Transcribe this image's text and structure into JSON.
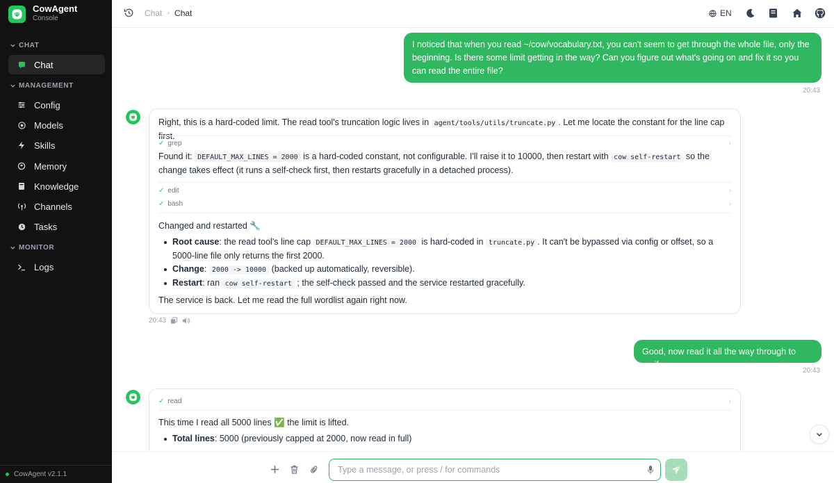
{
  "app": {
    "name": "CowAgent",
    "subtitle": "Console",
    "version": "CowAgent v2.1.1",
    "accent": "#2fb85f"
  },
  "sidebar": {
    "sections": [
      {
        "label": "CHAT"
      },
      {
        "label": "MANAGEMENT"
      },
      {
        "label": "MONITOR"
      }
    ],
    "items": [
      {
        "label": "Chat",
        "icon": "chat-icon",
        "active": true
      },
      {
        "label": "Config",
        "icon": "config-icon"
      },
      {
        "label": "Models",
        "icon": "models-icon"
      },
      {
        "label": "Skills",
        "icon": "lightning-icon"
      },
      {
        "label": "Memory",
        "icon": "memory-icon"
      },
      {
        "label": "Knowledge",
        "icon": "book-icon"
      },
      {
        "label": "Channels",
        "icon": "antenna-icon"
      },
      {
        "label": "Tasks",
        "icon": "clock-icon"
      },
      {
        "label": "Logs",
        "icon": "terminal-icon"
      }
    ]
  },
  "topbar": {
    "breadcrumb": [
      "Chat",
      "Chat"
    ],
    "language": "EN"
  },
  "messages": {
    "m1": {
      "text": "I noticed that when you read ~/cow/vocabulary.txt, you can't seem to get through the whole file, only the beginning. Is there some limit getting in the way? Can you figure out what's going on and fix it so you can read the entire file?",
      "time": "20:43"
    },
    "m2": {
      "intro_a": "Right, this is a hard-coded limit. The read tool's truncation logic lives in",
      "intro_code": "agent/tools/utils/truncate.py",
      "intro_b": ". Let me locate the constant for the line cap first.",
      "tool1": "grep",
      "found_a": "Found it:",
      "found_code1": "DEFAULT_MAX_LINES = 2000",
      "found_b": "is a hard-coded constant, not configurable. I'll raise it to 10000, then restart with",
      "found_code2": "cow self-restart",
      "found_c": "so the change takes effect (it runs a self-check first, then restarts gracefully in a detached process).",
      "tool2": "edit",
      "tool3": "bash",
      "changed": "Changed and restarted 🔧",
      "b1_label": "Root cause",
      "b1_a": ": the read tool's line cap",
      "b1_code1": "DEFAULT_MAX_LINES = 2000",
      "b1_b": "is hard-coded in",
      "b1_code2": "truncate.py",
      "b1_c": ". It can't be bypassed via config or offset, so a 5000-line file only returns the first 2000.",
      "b2_label": "Change",
      "b2_a": ":",
      "b2_code": "2000 -> 10000",
      "b2_b": "(backed up automatically, reversible).",
      "b3_label": "Restart",
      "b3_a": ": ran",
      "b3_code": "cow self-restart",
      "b3_b": "; the self-check passed and the service restarted gracefully.",
      "closing": "The service is back. Let me read the full wordlist again right now.",
      "time": "20:43"
    },
    "m3": {
      "text": "Good, now read it all the way through to verify.",
      "time": "20:43"
    },
    "m4": {
      "tool": "read",
      "line1": "This time I read all 5000 lines ✅ the limit is lifted.",
      "b1_label": "Total lines",
      "b1_text": ": 5000 (previously capped at 2000, now read in full)"
    }
  },
  "composer": {
    "placeholder": "Type a message, or press / for commands"
  }
}
